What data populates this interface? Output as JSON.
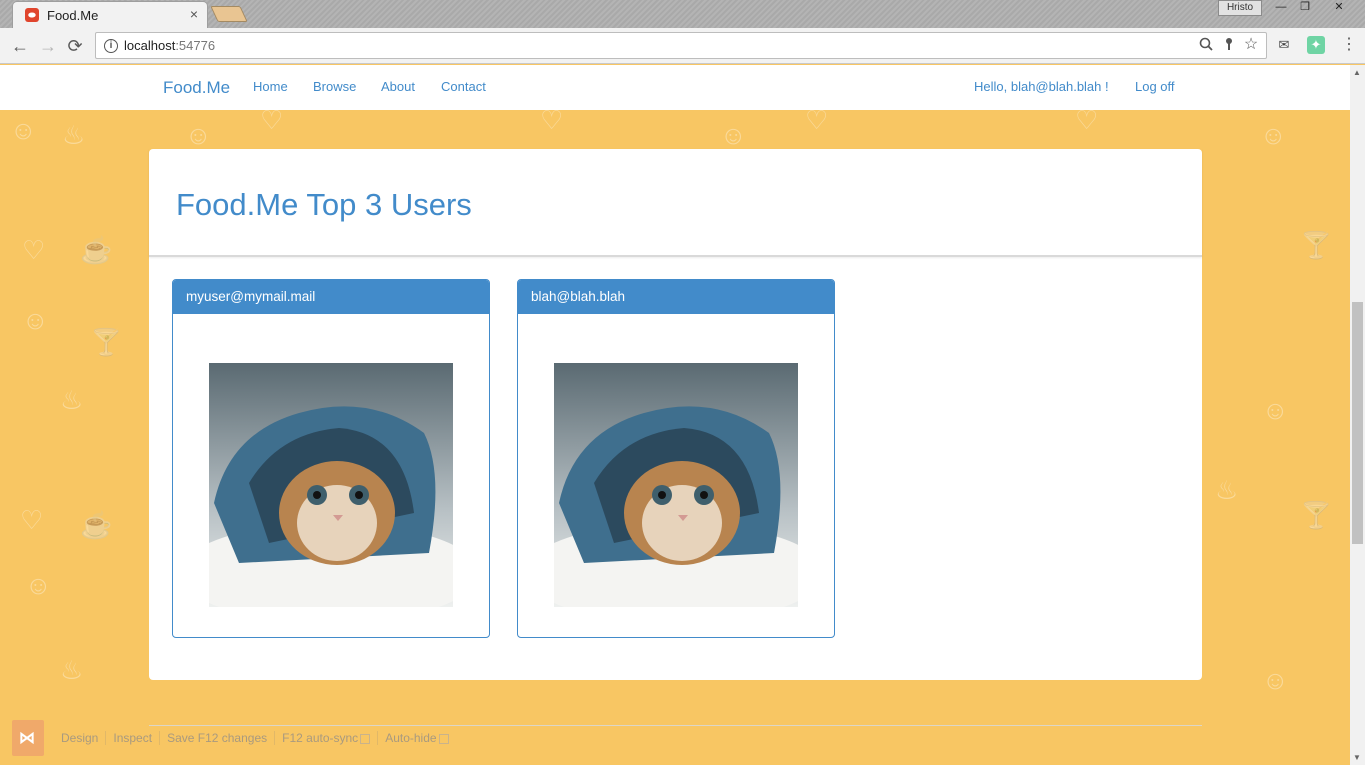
{
  "browser": {
    "tab_title": "Food.Me",
    "tab_close": "×",
    "user_badge": "Hristo",
    "url_host": "localhost",
    "url_port": ":54776",
    "win_min": "—",
    "win_restore": "❐",
    "win_close": "✕",
    "back": "←",
    "forward": "→",
    "reload": "⟳",
    "menu": "⋮"
  },
  "navbar": {
    "brand": "Food.Me",
    "links": [
      "Home",
      "Browse",
      "About",
      "Contact"
    ],
    "greeting": "Hello, blah@blah.blah !",
    "logoff": "Log off"
  },
  "panel": {
    "title": "Food.Me Top 3 Users",
    "users": [
      {
        "email": "myuser@mymail.mail"
      },
      {
        "email": "blah@blah.blah"
      }
    ]
  },
  "vs_toolbar": {
    "items": [
      "Design",
      "Inspect",
      "Save F12 changes",
      "F12 auto-sync",
      "Auto-hide"
    ]
  },
  "colors": {
    "background": "#f8c663",
    "accent": "#428bca"
  },
  "icons": {
    "info": "i",
    "zoom": "🔍",
    "key": "🔑",
    "star": "☆",
    "mail": "✉",
    "extension": "⬚"
  }
}
